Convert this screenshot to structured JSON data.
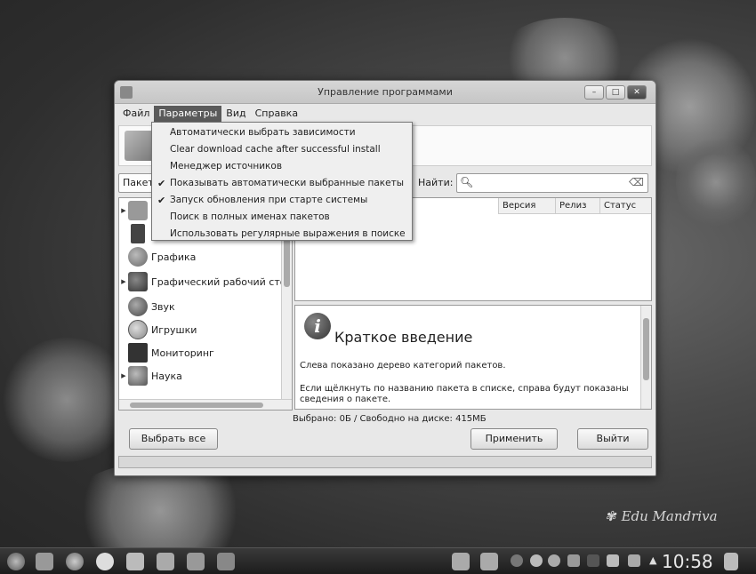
{
  "window": {
    "title": "Управление программами"
  },
  "menubar": {
    "file": "Файл",
    "options": "Параметры",
    "view": "Вид",
    "help": "Справка"
  },
  "dropdown": {
    "items": [
      {
        "label": "Автоматически выбрать зависимости",
        "checked": false
      },
      {
        "label": "Clear download cache after successful install",
        "checked": false
      },
      {
        "label": "Менеджер источников",
        "checked": false
      },
      {
        "label": "Показывать автоматически выбранные пакеты",
        "checked": true
      },
      {
        "label": "Запуск обновления при старте системы",
        "checked": true
      },
      {
        "label": "Поиск в полных именах пакетов",
        "checked": false
      },
      {
        "label": "Использовать регулярные выражения в поиске",
        "checked": false
      }
    ],
    "check_glyph": "✔"
  },
  "toolbar": {
    "filter_value": "Пакеты",
    "find_label": "Найти:",
    "search_value": ""
  },
  "tree": {
    "items": [
      {
        "label": "",
        "icon": "folder-icon",
        "expandable": true
      },
      {
        "label": "",
        "icon": "film-icon",
        "expandable": false
      },
      {
        "label": "Графика",
        "icon": "palette-icon",
        "expandable": false
      },
      {
        "label": "Графический рабочий стол",
        "icon": "desktop-icon",
        "expandable": true
      },
      {
        "label": "Звук",
        "icon": "speaker-icon",
        "expandable": false
      },
      {
        "label": "Игрушки",
        "icon": "smiley-icon",
        "expandable": false
      },
      {
        "label": "Мониторинг",
        "icon": "monitor-icon",
        "expandable": false
      },
      {
        "label": "Наука",
        "icon": "science-icon",
        "expandable": true
      }
    ]
  },
  "pkg_list": {
    "columns": [
      "Версия",
      "Релиз",
      "Статус"
    ]
  },
  "info": {
    "title": "Краткое введение",
    "p1": "Слева показано дерево категорий пакетов.",
    "p2": "Если щёлкнуть по названию пакета в списке, справа будут показаны сведения о пакете."
  },
  "status": {
    "text": "Выбрано: 0Б / Свободно на диске: 415МБ"
  },
  "buttons": {
    "select_all": "Выбрать все",
    "apply": "Применить",
    "quit": "Выйти"
  },
  "desktop": {
    "brand": "Edu Mandriva"
  },
  "taskbar": {
    "clock": "10:58"
  }
}
